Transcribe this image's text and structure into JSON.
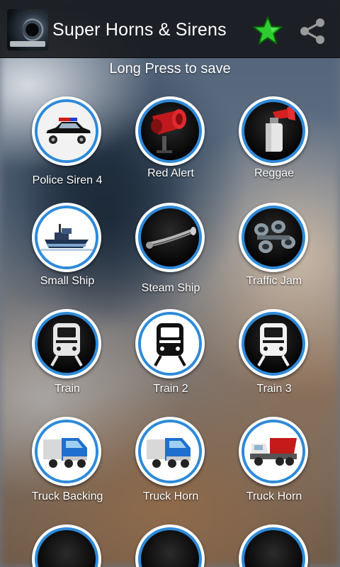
{
  "app": {
    "title": "Super Horns & Sirens",
    "hint": "Long Press to save"
  },
  "icons": {
    "favorite": "star-icon",
    "share": "share-icon",
    "favorite_color": "#2ecc2e"
  },
  "sounds": [
    {
      "label": "Police Siren 4",
      "icon": "police-car-icon"
    },
    {
      "label": "Red Alert",
      "icon": "red-alarm-horn-icon"
    },
    {
      "label": "Reggae",
      "icon": "air-horn-icon"
    },
    {
      "label": "Small Ship",
      "icon": "tugboat-icon"
    },
    {
      "label": "Steam Ship",
      "icon": "steam-horn-icon"
    },
    {
      "label": "Traffic Jam",
      "icon": "truck-horns-icon"
    },
    {
      "label": "Train",
      "icon": "train-icon"
    },
    {
      "label": "Train 2",
      "icon": "train-icon"
    },
    {
      "label": "Train 3",
      "icon": "train-icon"
    },
    {
      "label": "Truck Backing",
      "icon": "blue-truck-icon"
    },
    {
      "label": "Truck Horn",
      "icon": "blue-truck-icon"
    },
    {
      "label": "Truck Horn",
      "icon": "dump-truck-icon"
    }
  ],
  "colors": {
    "ring": "#2e8ad8",
    "app_bar": "#141619"
  }
}
